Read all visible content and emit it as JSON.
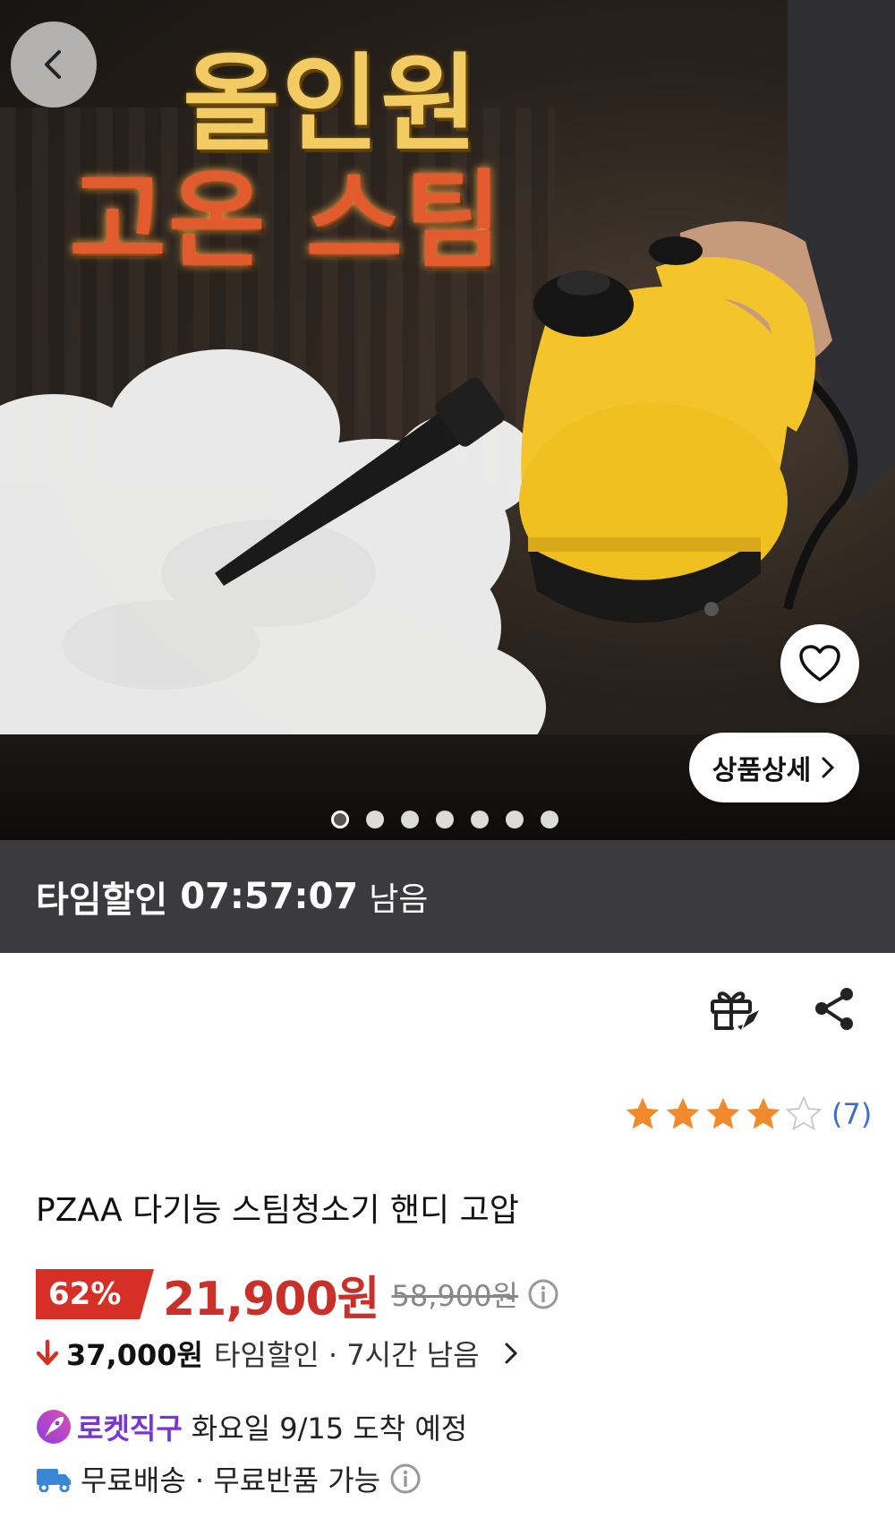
{
  "hero": {
    "headline_line1": "올인원",
    "headline_line2": "고온 스팀",
    "detail_button_label": "상품상세",
    "carousel_total": 7,
    "carousel_active": 1
  },
  "timer": {
    "label": "타임할인",
    "time": "07:57:07",
    "suffix": "남음"
  },
  "rating": {
    "stars": 4,
    "max": 5,
    "count_text": "(7)"
  },
  "product": {
    "title": "PZAA 다기능 스팀청소기 핸디 고압"
  },
  "price": {
    "discount": "62%",
    "sale": "21,900원",
    "original": "58,900원"
  },
  "time_discount": {
    "amount": "37,000원",
    "text": "타임할인 · 7시간 남음"
  },
  "delivery": {
    "brand": "로켓직구",
    "eta": "화요일 9/15 도착 예정",
    "shipping": "무료배송 · 무료반품 가능"
  },
  "colors": {
    "accent_red": "#d62f25",
    "price_red": "#c9302a",
    "rocket_purple": "#7a33d6",
    "star_orange": "#f08a2c",
    "link_blue": "#3d6fc7",
    "timer_bg": "#3b3b3d"
  },
  "icons": [
    "chevron-left-icon",
    "heart-icon",
    "chevron-right-icon",
    "gift-icon",
    "share-icon",
    "star-icon",
    "info-icon",
    "arrow-down-icon",
    "rocket-icon",
    "truck-icon"
  ]
}
